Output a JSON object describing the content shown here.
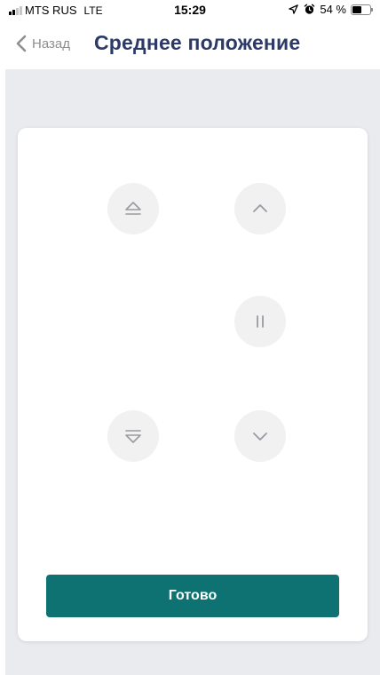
{
  "status_bar": {
    "carrier": "MTS RUS",
    "network": "LTE",
    "time": "15:29",
    "battery_percent": "54 %",
    "battery_level": 0.54,
    "icons": [
      "signal-icon",
      "location-arrow-icon",
      "alarm-icon",
      "battery-icon"
    ]
  },
  "nav": {
    "back_label": "Назад",
    "title": "Среднее положение"
  },
  "controls": {
    "buttons": [
      "open-full-icon",
      "up-icon",
      "pause-icon",
      "close-full-icon",
      "down-icon"
    ],
    "icon_color": "#9a9aa0",
    "button_bg": "#f1f1f2"
  },
  "done_button": {
    "label": "Готово",
    "color": "#0e7272"
  }
}
